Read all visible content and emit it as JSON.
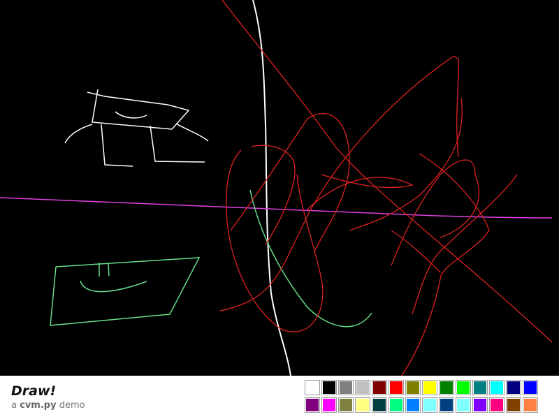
{
  "app": {
    "title": "Draw!",
    "subtitle_prefix": "a",
    "subtitle_brand": "cvm.py",
    "subtitle_suffix": "demo"
  },
  "canvas": {
    "background": "#000000"
  },
  "palette": {
    "row1": [
      "#FFFFFF",
      "#000000",
      "#808080",
      "#C0C0C0",
      "#800000",
      "#FF0000",
      "#808000",
      "#FFFF00",
      "#008000",
      "#00FF00",
      "#008080",
      "#00FFFF",
      "#000080",
      "#0000FF"
    ],
    "row2": [
      "#800080",
      "#FF00FF",
      "#808040",
      "#FFFF80",
      "#004040",
      "#00FF80",
      "#0080FF",
      "#80FFFF",
      "#004080",
      "#80FFFF",
      "#8000FF",
      "#FF0080",
      "#804000",
      "#FF8040"
    ]
  }
}
